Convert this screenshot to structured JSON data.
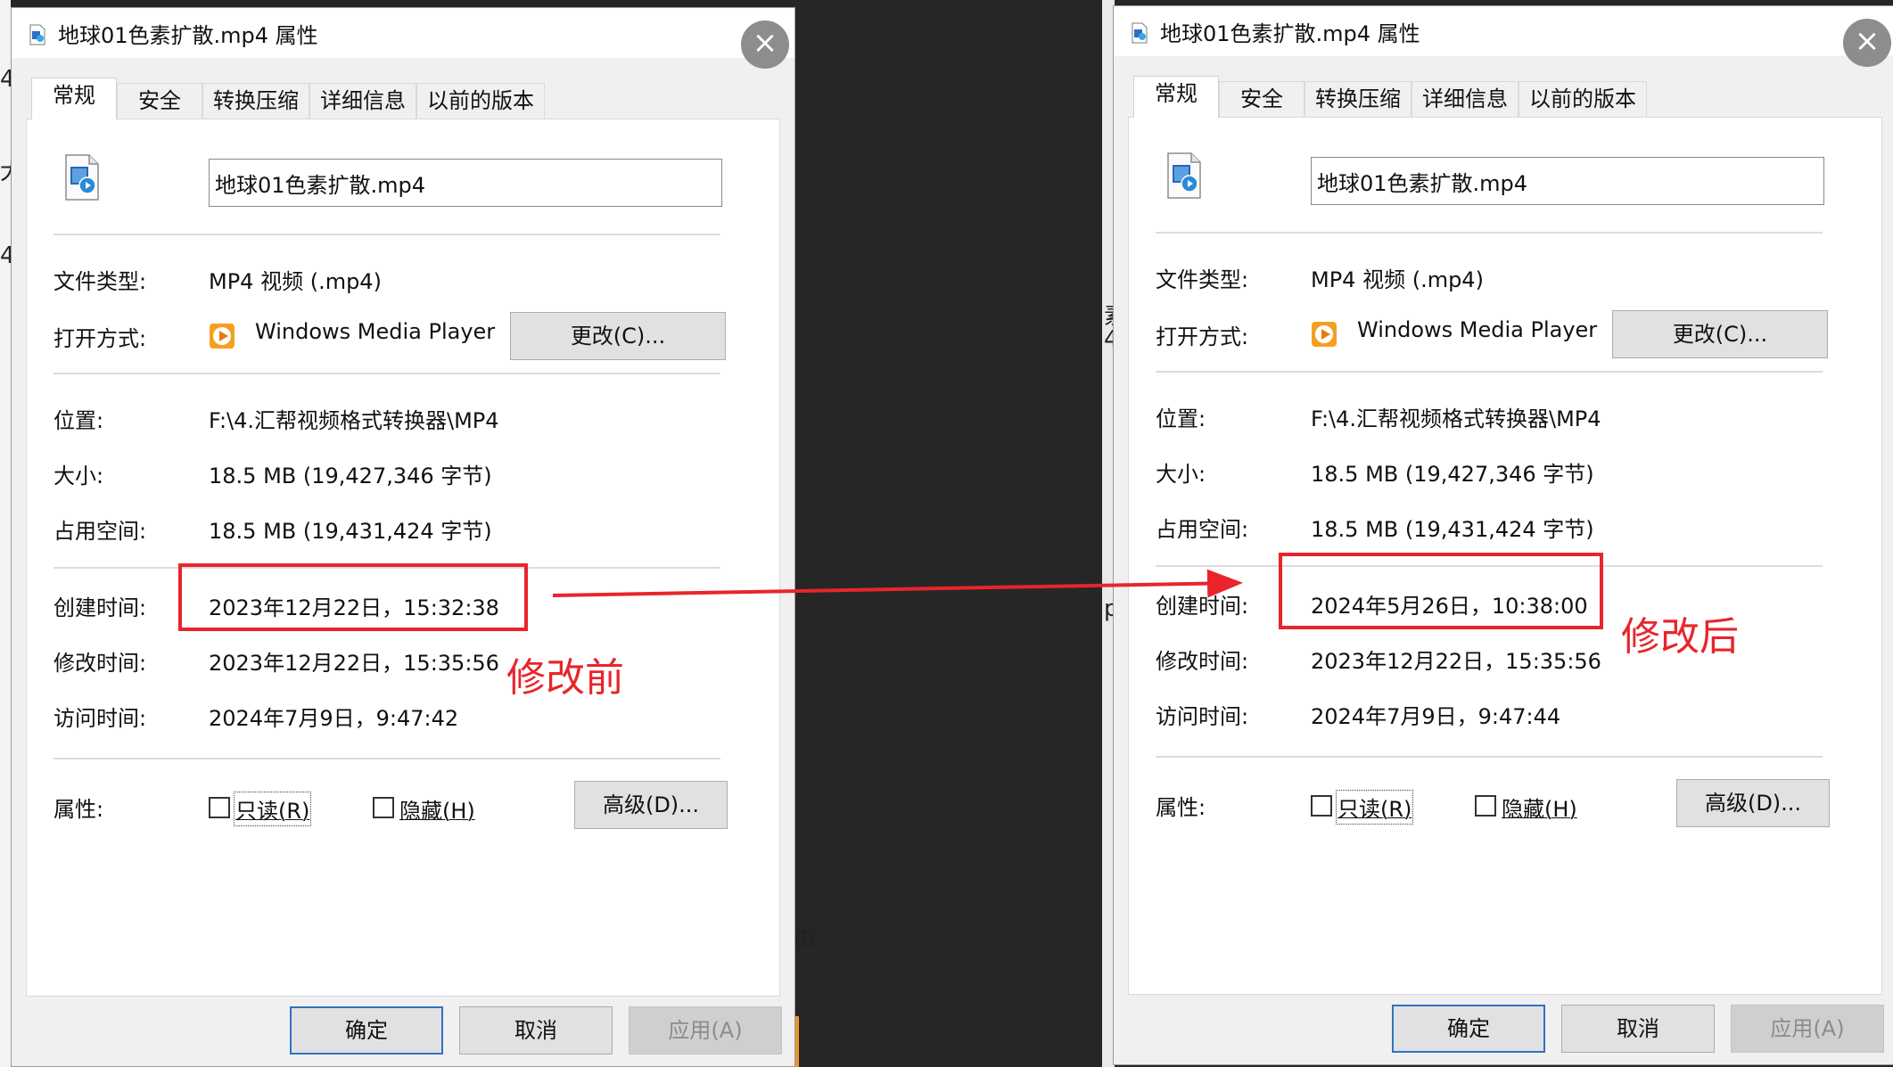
{
  "dialogs": [
    {
      "title": "地球01色素扩散.mp4 属性",
      "close_label": "×",
      "tabs": [
        "常规",
        "安全",
        "转换压缩",
        "详细信息",
        "以前的版本"
      ],
      "file_name": "地球01色素扩散.mp4",
      "labels": {
        "type": "文件类型:",
        "opens_with": "打开方式:",
        "location": "位置:",
        "size": "大小:",
        "size_on_disk": "占用空间:",
        "created": "创建时间:",
        "modified": "修改时间:",
        "accessed": "访问时间:",
        "attributes": "属性:"
      },
      "values": {
        "type": "MP4 视频 (.mp4)",
        "opens_with": "Windows Media Player",
        "location": "F:\\4.汇帮视频格式转换器\\MP4",
        "size": "18.5 MB (19,427,346 字节)",
        "size_on_disk": "18.5 MB (19,431,424 字节)",
        "created": "2023年12月22日，15:32:38",
        "modified": "2023年12月22日，15:35:56",
        "accessed": "2024年7月9日，9:47:42"
      },
      "buttons": {
        "change": "更改(C)...",
        "advanced": "高级(D)...",
        "ok": "确定",
        "cancel": "取消",
        "apply": "应用(A)"
      },
      "checkboxes": {
        "readonly": "只读(R)",
        "hidden": "隐藏(H)"
      }
    },
    {
      "title": "地球01色素扩散.mp4 属性",
      "close_label": "×",
      "tabs": [
        "常规",
        "安全",
        "转换压缩",
        "详细信息",
        "以前的版本"
      ],
      "file_name": "地球01色素扩散.mp4",
      "labels": {
        "type": "文件类型:",
        "opens_with": "打开方式:",
        "location": "位置:",
        "size": "大小:",
        "size_on_disk": "占用空间:",
        "created": "创建时间:",
        "modified": "修改时间:",
        "accessed": "访问时间:",
        "attributes": "属性:"
      },
      "values": {
        "type": "MP4 视频 (.mp4)",
        "opens_with": "Windows Media Player",
        "location": "F:\\4.汇帮视频格式转换器\\MP4",
        "size": "18.5 MB (19,427,346 字节)",
        "size_on_disk": "18.5 MB (19,431,424 字节)",
        "created": "2024年5月26日，10:38:00",
        "modified": "2023年12月22日，15:35:56",
        "accessed": "2024年7月9日，9:47:44"
      },
      "buttons": {
        "change": "更改(C)...",
        "advanced": "高级(D)...",
        "ok": "确定",
        "cancel": "取消",
        "apply": "应用(A)"
      },
      "checkboxes": {
        "readonly": "只读(R)",
        "hidden": "隐藏(H)"
      }
    }
  ],
  "annotations": {
    "before": "修改前",
    "after": "修改后",
    "color": "#e8252b"
  },
  "background_fragments": [
    "4",
    "犬",
    "4",
    "素",
    "4",
    "p",
    "由"
  ]
}
